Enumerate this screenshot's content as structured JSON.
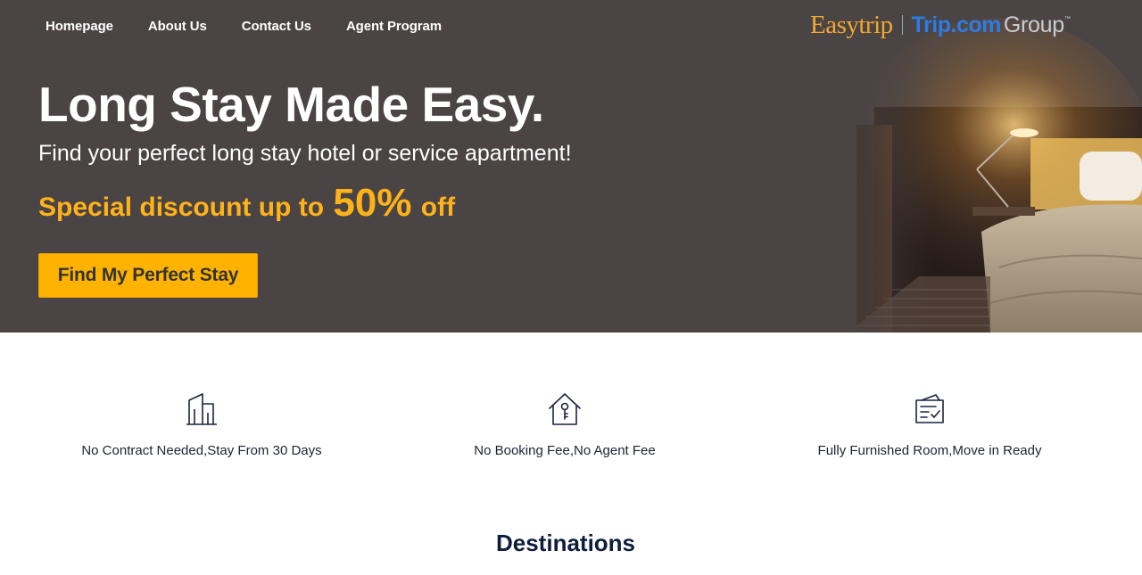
{
  "nav": {
    "items": [
      {
        "label": "Homepage"
      },
      {
        "label": "About Us"
      },
      {
        "label": "Contact Us"
      },
      {
        "label": "Agent Program"
      }
    ]
  },
  "logo": {
    "easytrip": "Easytrip",
    "trip": "Trip.com",
    "group": "Group",
    "tm": "™"
  },
  "hero": {
    "headline": "Long Stay Made Easy.",
    "subline": "Find your perfect long stay hotel or service apartment!",
    "discount_prefix": "Special discount up to",
    "discount_value": "50%",
    "discount_suffix": "off",
    "cta_label": "Find My Perfect Stay"
  },
  "features": [
    {
      "icon": "building-icon",
      "text": "No Contract Needed,Stay From 30 Days"
    },
    {
      "icon": "house-key-icon",
      "text": "No Booking Fee,No Agent Fee"
    },
    {
      "icon": "checklist-card-icon",
      "text": "Fully Furnished Room,Move in Ready"
    }
  ],
  "destinations": {
    "title": "Destinations"
  },
  "colors": {
    "hero_bg": "#4a4444",
    "accent": "#ffb300",
    "discount_text": "#ffb21a",
    "brand_blue": "#2d7be5",
    "brand_orange": "#f0a830",
    "heading_navy": "#0f1d3c"
  }
}
